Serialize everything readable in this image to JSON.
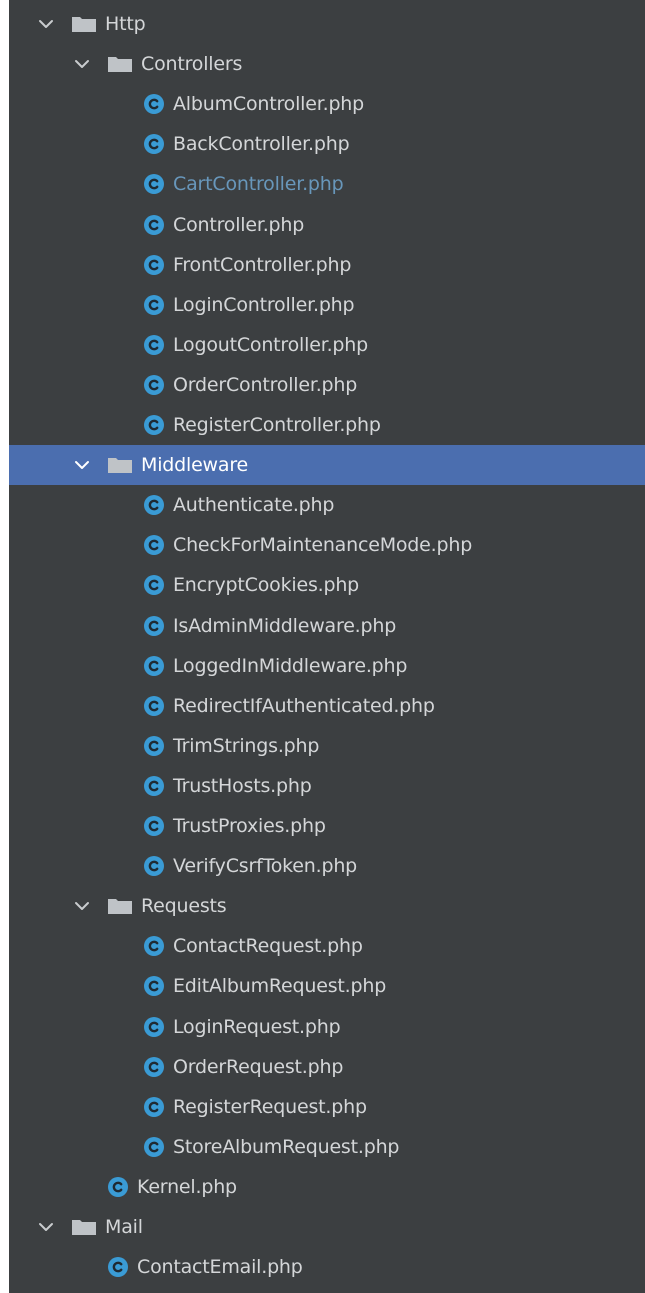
{
  "colors": {
    "panel_bg": "#3c3f41",
    "selection_bg": "#4b6eaf",
    "text": "#d4d6d8",
    "modified_text": "#6897bb",
    "class_icon": "#3a9bd5",
    "folder_icon": "#bfc3c7"
  },
  "tree": [
    {
      "kind": "folder",
      "depth": 0,
      "label": "Http",
      "expanded": true
    },
    {
      "kind": "folder",
      "depth": 1,
      "label": "Controllers",
      "expanded": true
    },
    {
      "kind": "class",
      "depth": 2,
      "label": "AlbumController.php",
      "icon": "php-class-icon"
    },
    {
      "kind": "class",
      "depth": 2,
      "label": "BackController.php",
      "icon": "php-class-icon"
    },
    {
      "kind": "class",
      "depth": 2,
      "label": "CartController.php",
      "icon": "php-class-icon",
      "modified": true
    },
    {
      "kind": "class",
      "depth": 2,
      "label": "Controller.php",
      "icon": "php-class-icon"
    },
    {
      "kind": "class",
      "depth": 2,
      "label": "FrontController.php",
      "icon": "php-class-icon"
    },
    {
      "kind": "class",
      "depth": 2,
      "label": "LoginController.php",
      "icon": "php-class-icon"
    },
    {
      "kind": "class",
      "depth": 2,
      "label": "LogoutController.php",
      "icon": "php-class-icon"
    },
    {
      "kind": "class",
      "depth": 2,
      "label": "OrderController.php",
      "icon": "php-class-icon"
    },
    {
      "kind": "class",
      "depth": 2,
      "label": "RegisterController.php",
      "icon": "php-class-icon"
    },
    {
      "kind": "folder",
      "depth": 1,
      "label": "Middleware",
      "expanded": true,
      "selected": true
    },
    {
      "kind": "class",
      "depth": 2,
      "label": "Authenticate.php",
      "icon": "php-class-icon"
    },
    {
      "kind": "class",
      "depth": 2,
      "label": "CheckForMaintenanceMode.php",
      "icon": "php-class-icon"
    },
    {
      "kind": "class",
      "depth": 2,
      "label": "EncryptCookies.php",
      "icon": "php-class-icon"
    },
    {
      "kind": "class",
      "depth": 2,
      "label": "IsAdminMiddleware.php",
      "icon": "php-class-icon"
    },
    {
      "kind": "class",
      "depth": 2,
      "label": "LoggedInMiddleware.php",
      "icon": "php-class-icon"
    },
    {
      "kind": "class",
      "depth": 2,
      "label": "RedirectIfAuthenticated.php",
      "icon": "php-class-icon"
    },
    {
      "kind": "class",
      "depth": 2,
      "label": "TrimStrings.php",
      "icon": "php-class-icon"
    },
    {
      "kind": "class",
      "depth": 2,
      "label": "TrustHosts.php",
      "icon": "php-class-icon"
    },
    {
      "kind": "class",
      "depth": 2,
      "label": "TrustProxies.php",
      "icon": "php-class-icon"
    },
    {
      "kind": "class",
      "depth": 2,
      "label": "VerifyCsrfToken.php",
      "icon": "php-class-icon"
    },
    {
      "kind": "folder",
      "depth": 1,
      "label": "Requests",
      "expanded": true
    },
    {
      "kind": "class",
      "depth": 2,
      "label": "ContactRequest.php",
      "icon": "php-class-icon"
    },
    {
      "kind": "class",
      "depth": 2,
      "label": "EditAlbumRequest.php",
      "icon": "php-class-icon"
    },
    {
      "kind": "class",
      "depth": 2,
      "label": "LoginRequest.php",
      "icon": "php-class-icon"
    },
    {
      "kind": "class",
      "depth": 2,
      "label": "OrderRequest.php",
      "icon": "php-class-icon"
    },
    {
      "kind": "class",
      "depth": 2,
      "label": "RegisterRequest.php",
      "icon": "php-class-icon"
    },
    {
      "kind": "class",
      "depth": 2,
      "label": "StoreAlbumRequest.php",
      "icon": "php-class-icon"
    },
    {
      "kind": "class",
      "depth": 1,
      "label": "Kernel.php",
      "icon": "php-class-icon"
    },
    {
      "kind": "folder",
      "depth": 0,
      "label": "Mail",
      "expanded": true
    },
    {
      "kind": "class",
      "depth": 1,
      "label": "ContactEmail.php",
      "icon": "php-class-icon"
    }
  ]
}
